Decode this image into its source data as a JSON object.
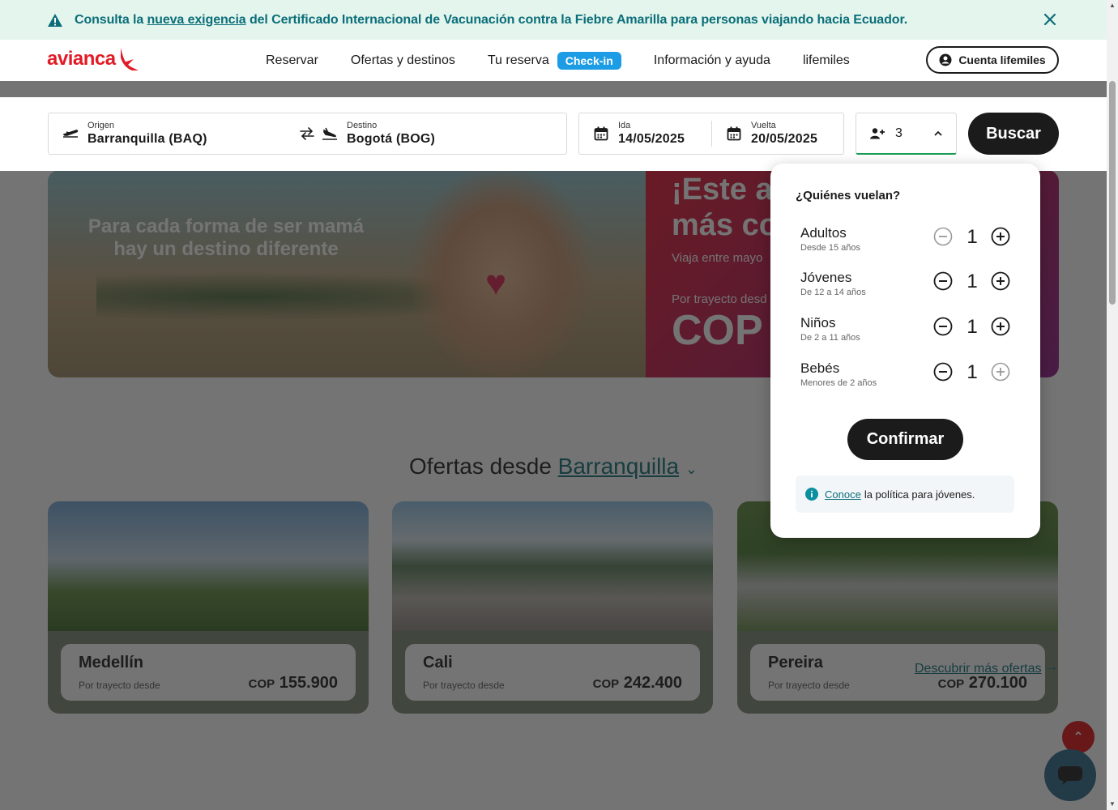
{
  "notice": {
    "prefix": "Consulta la ",
    "link": "nueva exigencia",
    "suffix": " del Certificado Internacional de Vacunación contra la Fiebre Amarilla para personas viajando hacia Ecuador."
  },
  "header": {
    "logo": "avianca",
    "nav": [
      "Reservar",
      "Ofertas y destinos",
      "Tu reserva",
      "Información y ayuda",
      "lifemiles"
    ],
    "checkin": "Check-in",
    "account": "Cuenta lifemiles"
  },
  "search": {
    "origin_label": "Origen",
    "origin_value": "Barranquilla (BAQ)",
    "dest_label": "Destino",
    "dest_value": "Bogotá (BOG)",
    "ida_label": "Ida",
    "ida_value": "14/05/2025",
    "vuelta_label": "Vuelta",
    "vuelta_value": "20/05/2025",
    "passengers": "3",
    "button": "Buscar"
  },
  "hero": {
    "tagline": "Para cada forma de ser mamá hay un destino diferente",
    "headline_1": "¡Este añ",
    "headline_2": "más co",
    "sub": "Viaja entre mayo",
    "small": "Por trayecto desd",
    "price": "COP"
  },
  "offers": {
    "title": "Ofertas desde",
    "city": "Barranquilla",
    "cards": [
      {
        "city": "Medellín",
        "desde": "Por trayecto desde",
        "currency": "COP",
        "price": "155.900"
      },
      {
        "city": "Cali",
        "desde": "Por trayecto desde",
        "currency": "COP",
        "price": "242.400"
      },
      {
        "city": "Pereira",
        "desde": "Por trayecto desde",
        "currency": "COP",
        "price": "270.100"
      }
    ],
    "more": "Descubrir más ofertas"
  },
  "passenger_panel": {
    "question": "¿Quiénes vuelan?",
    "rows": [
      {
        "name": "Adultos",
        "age": "Desde 15 años",
        "count": "1"
      },
      {
        "name": "Jóvenes",
        "age": "De 12 a 14 años",
        "count": "1"
      },
      {
        "name": "Niños",
        "age": "De 2 a 11 años",
        "count": "1"
      },
      {
        "name": "Bebés",
        "age": "Menores de 2 años",
        "count": "1"
      }
    ],
    "confirm": "Confirmar",
    "policy_link": "Conoce",
    "policy_text": "la política para jóvenes."
  }
}
